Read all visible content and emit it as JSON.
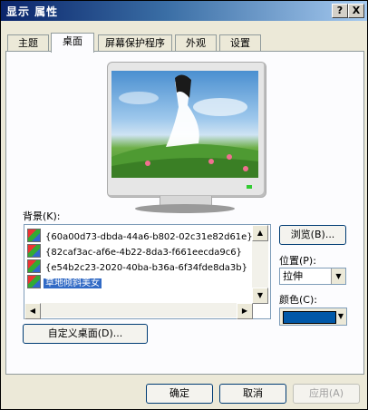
{
  "window": {
    "title": "显示 属性",
    "help_label": "?",
    "close_label": "X"
  },
  "tabs": [
    {
      "label": "主题"
    },
    {
      "label": "桌面"
    },
    {
      "label": "屏幕保护程序"
    },
    {
      "label": "外观"
    },
    {
      "label": "设置"
    }
  ],
  "desktop": {
    "background_label": "背景(K):",
    "background_items": [
      {
        "label": "{60a00d73-dbda-44a6-b802-02c31e82d61e}"
      },
      {
        "label": "{82caf3ac-af6e-4b22-8da3-f661eecda9c6}"
      },
      {
        "label": "{e54b2c23-2020-40ba-b36a-6f34fde8da3b}"
      },
      {
        "label": "草地倾斜美女"
      }
    ],
    "selected_index": 3,
    "browse_label": "浏览(B)...",
    "position_label": "位置(P):",
    "position_value": "拉伸",
    "color_label": "颜色(C):",
    "color_value": "#0058a8",
    "customize_label": "自定义桌面(D)...",
    "wallpaper_icon": "preview-image"
  },
  "footer": {
    "ok_label": "确定",
    "cancel_label": "取消",
    "apply_label": "应用(A)"
  },
  "colors": {
    "titlebar_start": "#0a246a",
    "selection": "#316ac5",
    "dialog_bg": "#ece9d8"
  }
}
